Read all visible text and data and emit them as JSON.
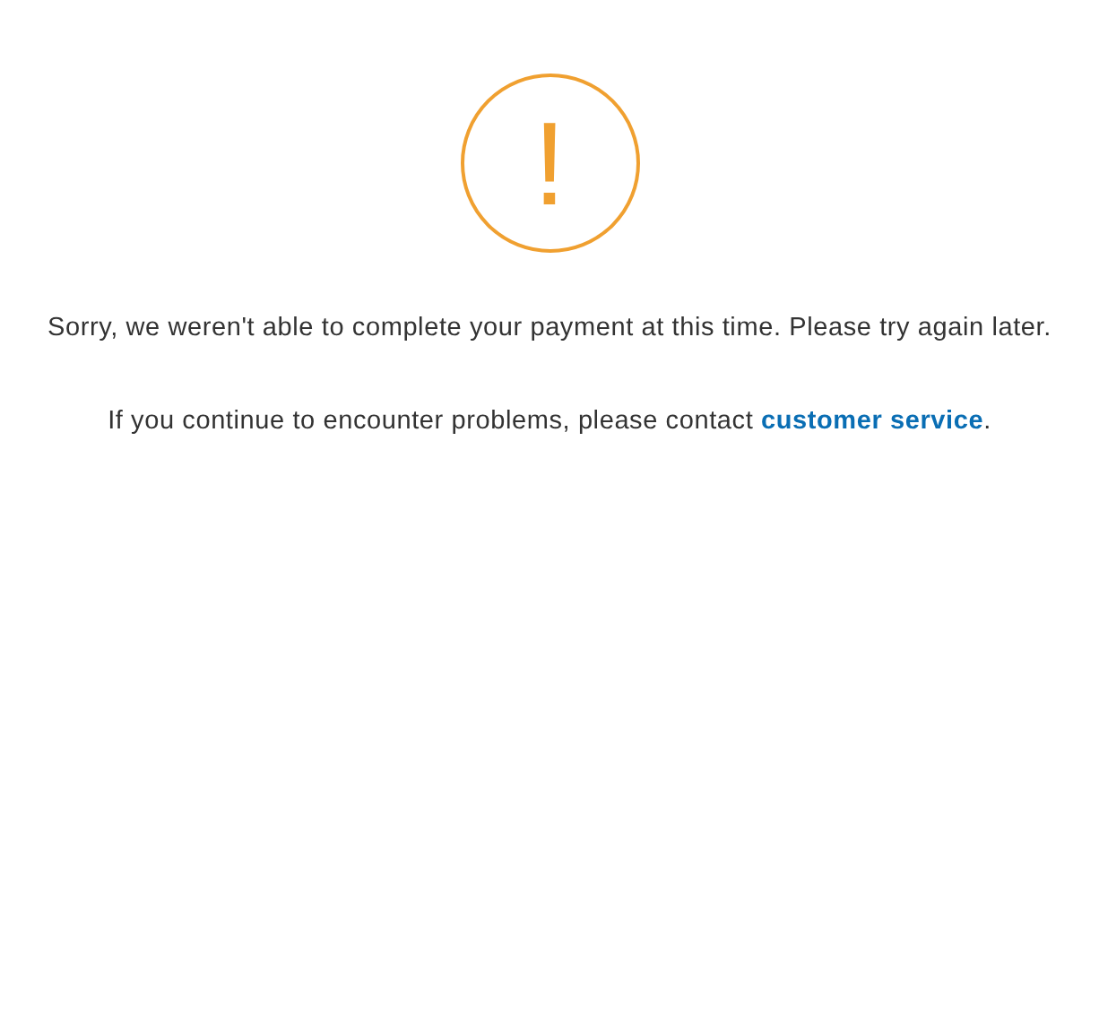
{
  "alert": {
    "icon": "!"
  },
  "message": "Sorry, we weren't able to complete your payment at this time. Please try again later.",
  "contact": {
    "before": "If you continue to encounter problems, please contact ",
    "link": "customer service",
    "after": "."
  }
}
